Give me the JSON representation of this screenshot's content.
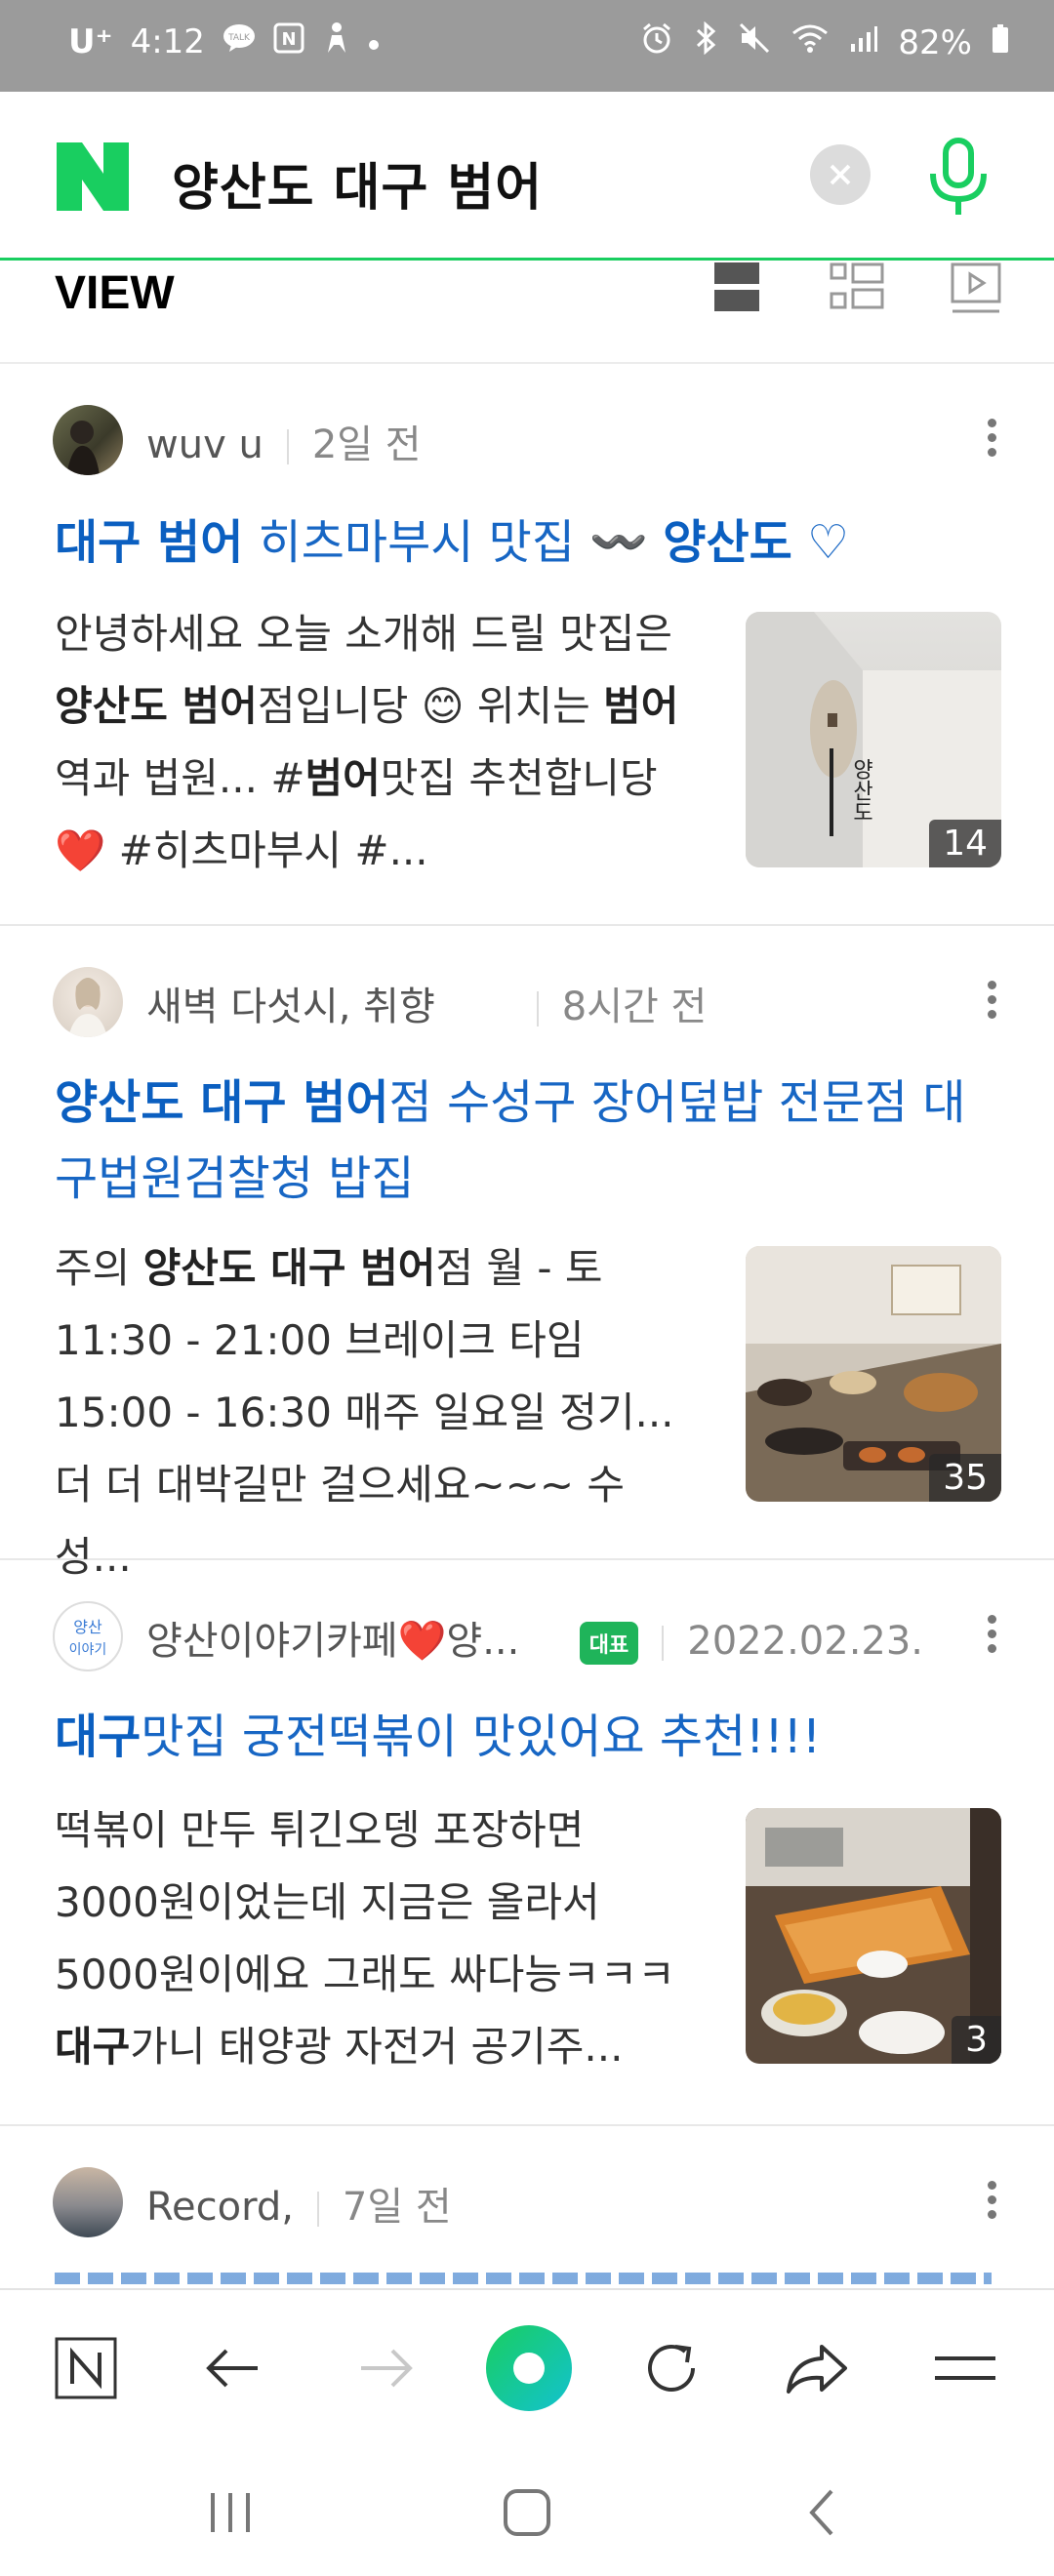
{
  "status_bar": {
    "carrier": "U⁺",
    "time": "4:12",
    "talk_icon_label": "TALK",
    "notif_icon_label": "N",
    "battery": "82%"
  },
  "search": {
    "query": "양산도 대구 범어"
  },
  "view_section": {
    "title": "VIEW"
  },
  "cards": [
    {
      "author": "wuv u",
      "time": "2일 전",
      "title_parts": [
        {
          "text": "대구 범어",
          "bold": true
        },
        {
          "text": " 히츠마부시 맛집 〰️ ",
          "bold": false
        },
        {
          "text": "양산도",
          "bold": true
        },
        {
          "text": " ♡",
          "bold": false
        }
      ],
      "desc_parts": [
        {
          "text": "안녕하세요 오늘 소개해 드릴 맛집은 ",
          "bold": false
        },
        {
          "text": "양산도 범어",
          "bold": true
        },
        {
          "text": "점입니당 😊 위치는 ",
          "bold": false
        },
        {
          "text": "범어",
          "bold": true
        },
        {
          "text": "역과 법원... #",
          "bold": false
        },
        {
          "text": "범어",
          "bold": true
        },
        {
          "text": "맛집 추천합니당 ❤️ #히츠마부시 #...",
          "bold": false
        }
      ],
      "thumb_count": "14",
      "thumb_sign": "양산도"
    },
    {
      "author": "새벽 다섯시, 취향",
      "time": "8시간 전",
      "title_parts": [
        {
          "text": "양산도 대구 범어",
          "bold": true
        },
        {
          "text": "점 수성구 장어덮밥 전문점 대구법원검찰청 밥집",
          "bold": false
        }
      ],
      "desc_parts": [
        {
          "text": "주의 ",
          "bold": false
        },
        {
          "text": "양산도 대구 범어",
          "bold": true
        },
        {
          "text": "점 월 - 토 11:30 - 21:00 브레이크 타임 15:00 - 16:30 매주 일요일 정기... 더 더 대박길만 걸으세요~~~ 수성...",
          "bold": false
        }
      ],
      "thumb_count": "35"
    },
    {
      "author": "양산이야기카페❤️양...",
      "badge": "대표",
      "time": "2022.02.23.",
      "avatar_text": "양산 이야기",
      "title_parts": [
        {
          "text": "대구",
          "bold": true
        },
        {
          "text": "맛집 궁전떡볶이 맛있어요 추천!!!!",
          "bold": false
        }
      ],
      "desc_parts": [
        {
          "text": "떡볶이 만두 튀긴오뎅 포장하면 3000원이었는데 지금은 올라서 5000원이에요 그래도 싸다능ㅋㅋㅋ ",
          "bold": false
        },
        {
          "text": "대구",
          "bold": true
        },
        {
          "text": "가니 태양광 자전거 공기주...",
          "bold": false
        }
      ],
      "thumb_count": "3"
    },
    {
      "author": "Record,",
      "time": "7일 전"
    }
  ],
  "icons": {
    "status": [
      "talk-icon",
      "naver-notification-icon",
      "person-icon",
      "dot-icon",
      "alarm-icon",
      "bluetooth-icon",
      "mute-icon",
      "wifi-icon",
      "signal-icon",
      "battery-icon"
    ],
    "nav": [
      "naver-home-icon",
      "back-arrow-icon",
      "forward-arrow-icon",
      "green-dot-icon",
      "refresh-icon",
      "share-icon",
      "menu-icon"
    ],
    "system": [
      "recent-apps-icon",
      "home-icon",
      "back-icon"
    ]
  },
  "colors": {
    "naver_green": "#19ce60",
    "title_blue": "#1766c4",
    "status_gray": "#9b9b9b"
  }
}
